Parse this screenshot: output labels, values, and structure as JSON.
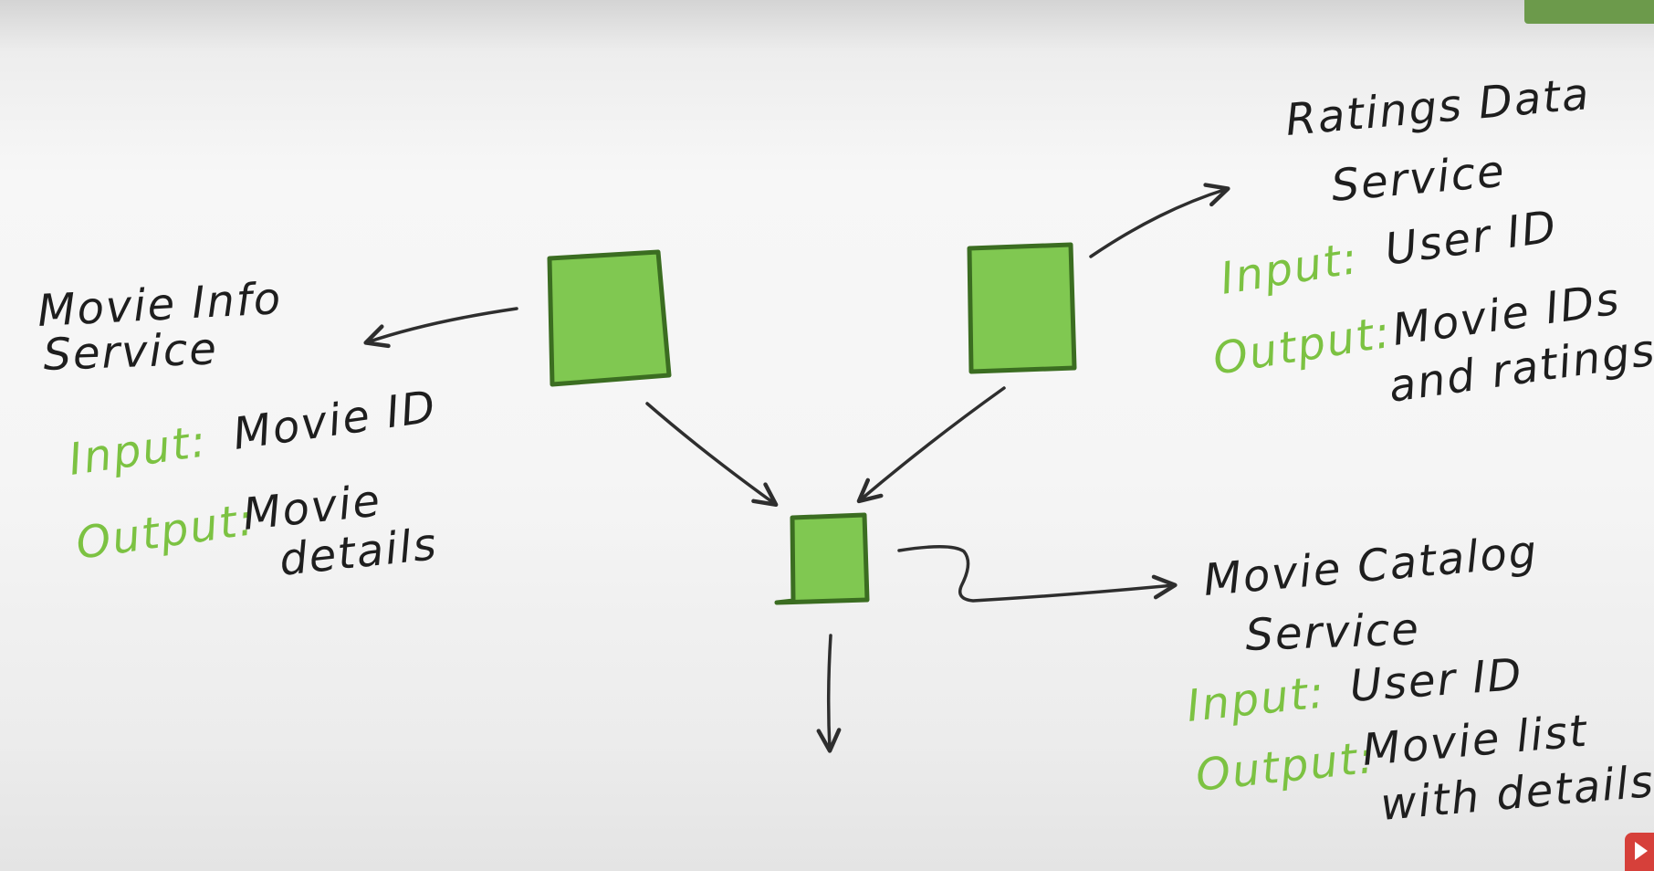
{
  "colors": {
    "node_fill": "#80c851",
    "node_stroke": "#3b6d21",
    "label_accent": "#7cc242",
    "ink": "#1e1e1e"
  },
  "nodes": {
    "movie_info": {
      "name": "movie-info-service-box"
    },
    "ratings_data": {
      "name": "ratings-data-service-box"
    },
    "movie_catalog": {
      "name": "movie-catalog-service-box"
    }
  },
  "movie_info": {
    "title_line1": "Movie Info",
    "title_line2": "Service",
    "input_label": "Input:",
    "input_value": "Movie ID",
    "output_label": "Output:",
    "output_line1": "Movie",
    "output_line2": "details"
  },
  "ratings_data": {
    "title_line1": "Ratings Data",
    "title_line2": "Service",
    "input_label": "Input:",
    "input_value": "User ID",
    "output_label": "Output:",
    "output_line1": "Movie IDs",
    "output_line2": "and ratings"
  },
  "movie_catalog": {
    "title_line1": "Movie Catalog",
    "title_line2": "Service",
    "input_label": "Input:",
    "input_value": "User ID",
    "output_label": "Output:",
    "output_line1": "Movie list",
    "output_line2": "with details"
  },
  "edges": [
    {
      "from": "movie_info",
      "to": "movie_info_label"
    },
    {
      "from": "ratings_data",
      "to": "ratings_data_label"
    },
    {
      "from": "movie_info",
      "to": "movie_catalog"
    },
    {
      "from": "ratings_data",
      "to": "movie_catalog"
    },
    {
      "from": "movie_catalog",
      "to": "movie_catalog_label"
    },
    {
      "from": "movie_catalog",
      "to": "output"
    }
  ]
}
